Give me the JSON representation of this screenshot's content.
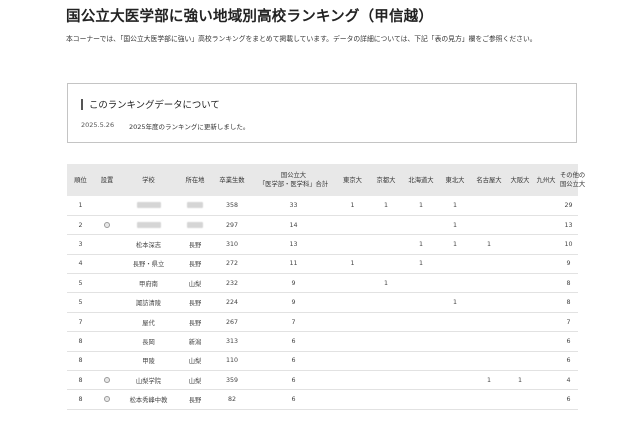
{
  "page": {
    "title": "国公立大医学部に強い地域別高校ランキング（甲信越）",
    "intro": "本コーナーでは、「国公立大医学部に強い」高校ランキングをまとめて掲載しています。データの詳細については、下記「表の見方」欄をご参照ください。"
  },
  "notice": {
    "title": "このランキングデータについて",
    "date": "2025.5.26",
    "text": "2025年度のランキングに更新しました。"
  },
  "table": {
    "headers": {
      "rank": "順位",
      "setsu": "設置",
      "school": "学校",
      "location": "所在地",
      "graduates": "卒業生数",
      "total_line1": "国公立大",
      "total_line2": "「医学部・医学科」合計",
      "u1": "東京大",
      "u2": "京都大",
      "u3": "北海道大",
      "u4": "東北大",
      "u5": "名古屋大",
      "u6": "大阪大",
      "u7": "九州大",
      "other_line1": "その他の",
      "other_line2": "国公立大"
    },
    "rows": [
      {
        "rank": "1",
        "school": "",
        "location": "",
        "graduates": "358",
        "total": "33",
        "u1": "1",
        "u2": "1",
        "u3": "1",
        "u4": "1",
        "u5": "",
        "u6": "",
        "u7": "",
        "other": "29",
        "icon": false
      },
      {
        "rank": "2",
        "school": "",
        "location": "",
        "graduates": "297",
        "total": "14",
        "u1": "",
        "u2": "",
        "u3": "",
        "u4": "1",
        "u5": "",
        "u6": "",
        "u7": "",
        "other": "13",
        "icon": true
      },
      {
        "rank": "3",
        "school": "松本深志",
        "location": "長野",
        "graduates": "310",
        "total": "13",
        "u1": "",
        "u2": "",
        "u3": "1",
        "u4": "1",
        "u5": "1",
        "u6": "",
        "u7": "",
        "other": "10",
        "icon": false
      },
      {
        "rank": "4",
        "school": "長野・県立",
        "location": "長野",
        "graduates": "272",
        "total": "11",
        "u1": "1",
        "u2": "",
        "u3": "1",
        "u4": "",
        "u5": "",
        "u6": "",
        "u7": "",
        "other": "9",
        "icon": false
      },
      {
        "rank": "5",
        "school": "甲府南",
        "location": "山梨",
        "graduates": "232",
        "total": "9",
        "u1": "",
        "u2": "1",
        "u3": "",
        "u4": "",
        "u5": "",
        "u6": "",
        "u7": "",
        "other": "8",
        "icon": false
      },
      {
        "rank": "5",
        "school": "諏訪清陵",
        "location": "長野",
        "graduates": "224",
        "total": "9",
        "u1": "",
        "u2": "",
        "u3": "",
        "u4": "1",
        "u5": "",
        "u6": "",
        "u7": "",
        "other": "8",
        "icon": false
      },
      {
        "rank": "7",
        "school": "屋代",
        "location": "長野",
        "graduates": "267",
        "total": "7",
        "u1": "",
        "u2": "",
        "u3": "",
        "u4": "",
        "u5": "",
        "u6": "",
        "u7": "",
        "other": "7",
        "icon": false
      },
      {
        "rank": "8",
        "school": "長岡",
        "location": "新潟",
        "graduates": "313",
        "total": "6",
        "u1": "",
        "u2": "",
        "u3": "",
        "u4": "",
        "u5": "",
        "u6": "",
        "u7": "",
        "other": "6",
        "icon": false
      },
      {
        "rank": "8",
        "school": "甲陵",
        "location": "山梨",
        "graduates": "110",
        "total": "6",
        "u1": "",
        "u2": "",
        "u3": "",
        "u4": "",
        "u5": "",
        "u6": "",
        "u7": "",
        "other": "6",
        "icon": false
      },
      {
        "rank": "8",
        "school": "山梨学院",
        "location": "山梨",
        "graduates": "359",
        "total": "6",
        "u1": "",
        "u2": "",
        "u3": "",
        "u4": "",
        "u5": "1",
        "u6": "1",
        "u7": "",
        "other": "4",
        "icon": true
      },
      {
        "rank": "8",
        "school": "松本秀峰中教",
        "location": "長野",
        "graduates": "82",
        "total": "6",
        "u1": "",
        "u2": "",
        "u3": "",
        "u4": "",
        "u5": "",
        "u6": "",
        "u7": "",
        "other": "6",
        "icon": true
      }
    ]
  }
}
